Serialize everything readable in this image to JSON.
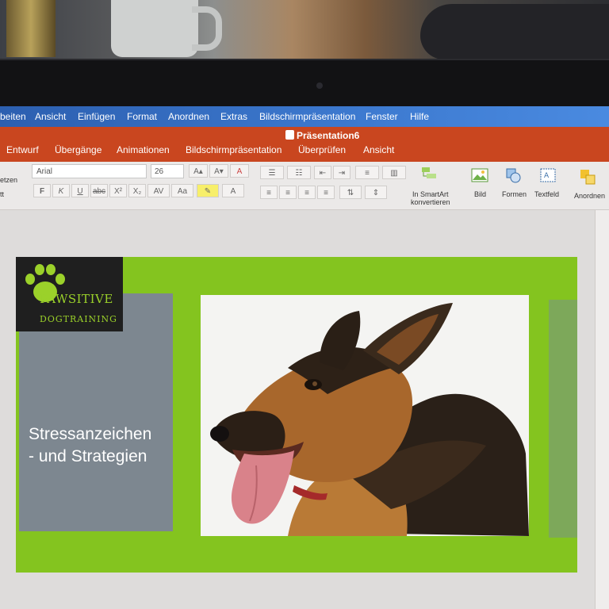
{
  "menubar": {
    "items": [
      "beiten",
      "Ansicht",
      "Einfügen",
      "Format",
      "Anordnen",
      "Extras",
      "Bildschirmpräsentation",
      "Fenster",
      "Hilfe"
    ]
  },
  "titlebar": {
    "document_title": "Präsentation6"
  },
  "ribbon": {
    "tabs": [
      "Entwurf",
      "Übergänge",
      "Animationen",
      "Bildschirmpräsentation",
      "Überprüfen",
      "Ansicht"
    ],
    "left_labels": [
      "etzen",
      "tt"
    ],
    "font_name": "Arial",
    "font_size": "26",
    "format_buttons": [
      "F",
      "K",
      "U",
      "abc",
      "X²",
      "X₂"
    ],
    "smartart_label_line1": "In SmartArt",
    "smartart_label_line2": "konvertieren",
    "bild_label": "Bild",
    "formen_label": "Formen",
    "textfeld_label": "Textfeld",
    "anordnen_label": "Anordnen"
  },
  "slide": {
    "logo_brand": "PAWSITIVE",
    "logo_sub": "DOGTRAINING",
    "title_line1": "Stressanzeichen",
    "title_line2": "- und Strategien",
    "photo": "german-shepherd-dog"
  },
  "colors": {
    "menubar": "#3a73c8",
    "ribbon": "#c9461f",
    "slide_green": "#84c41f",
    "panel_grey": "#7d8790",
    "logo_green": "#9bd12a"
  }
}
